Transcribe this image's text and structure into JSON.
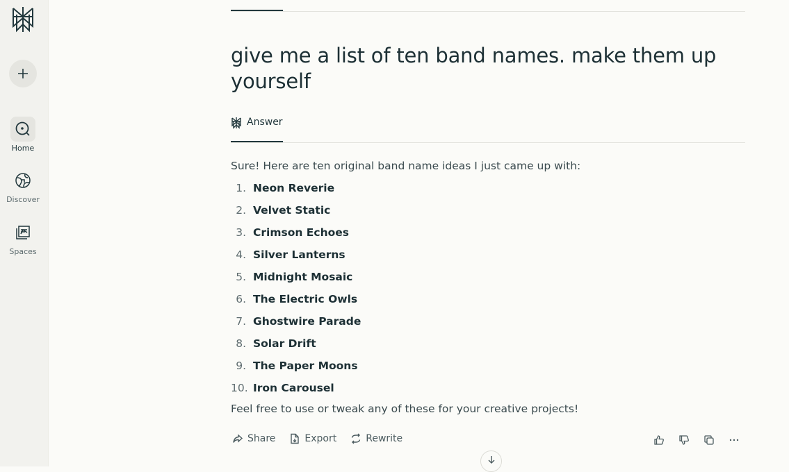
{
  "sidebar": {
    "items": [
      {
        "label": "Home",
        "icon": "home-search-icon",
        "active": true
      },
      {
        "label": "Discover",
        "icon": "globe-icon",
        "active": false
      },
      {
        "label": "Spaces",
        "icon": "spaces-icon",
        "active": false
      }
    ]
  },
  "thread": {
    "question": "give me a list of ten band names. make them up yourself",
    "answer_tab_label": "Answer",
    "intro": "Sure! Here are ten original band name ideas I just came up with:",
    "bands": [
      {
        "num": "1.",
        "name": "Neon Reverie"
      },
      {
        "num": "2.",
        "name": "Velvet Static"
      },
      {
        "num": "3.",
        "name": "Crimson Echoes"
      },
      {
        "num": "4.",
        "name": "Silver Lanterns"
      },
      {
        "num": "5.",
        "name": "Midnight Mosaic"
      },
      {
        "num": "6.",
        "name": "The Electric Owls"
      },
      {
        "num": "7.",
        "name": "Ghostwire Parade"
      },
      {
        "num": "8.",
        "name": "Solar Drift"
      },
      {
        "num": "9.",
        "name": "The Paper Moons"
      },
      {
        "num": "10.",
        "name": "Iron Carousel"
      }
    ],
    "outro": "Feel free to use or tweak any of these for your creative projects!"
  },
  "actions": {
    "share": "Share",
    "export": "Export",
    "rewrite": "Rewrite"
  },
  "colors": {
    "background": "#fbfbf8",
    "sidebar": "#f2f2ee",
    "text_primary": "#1d3035",
    "accent": "#22383d"
  }
}
